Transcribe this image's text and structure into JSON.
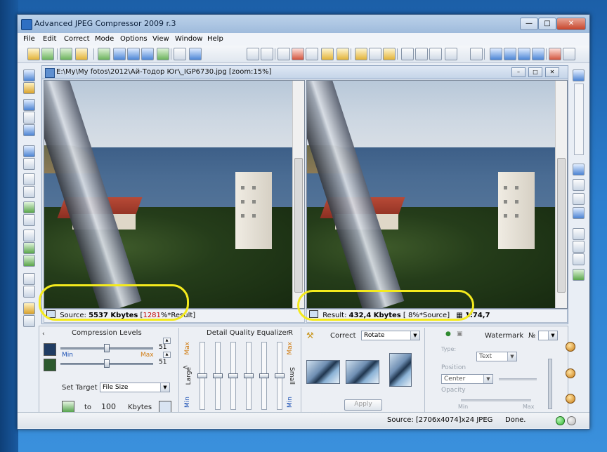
{
  "window": {
    "title": "Advanced JPEG Compressor 2009 r.3"
  },
  "menu": [
    "File",
    "Edit",
    "Correct",
    "Mode",
    "Options",
    "View",
    "Window",
    "Help"
  ],
  "document": {
    "title": "E:\\My\\My fotos\\2012\\Ай-Тодор Юг\\_IGP6730.jpg  [zoom:15%]",
    "source_label": "Source:",
    "source_size": "5537 Kbytes",
    "source_ratio_open": "[",
    "source_ratio": "1281",
    "source_ratio_suffix": "%*Result]",
    "result_label": "Result:",
    "result_size": "432,4 Kbytes",
    "result_ratio": "[ 8%*Source]",
    "compression_ratio": "1:74,7"
  },
  "compression": {
    "title": "Compression Levels",
    "min_label": "Min",
    "max_label": "Max",
    "level1": "51",
    "level2": "51",
    "level1_fraction": 0.5,
    "level2_fraction": 0.5,
    "set_target_label": "Set Target",
    "set_target_value": "File Size",
    "to_label": "to",
    "target_value": "100",
    "target_unit": "Kbytes"
  },
  "equalizer": {
    "title": "Detail Quality Equalizer",
    "r_label": "R",
    "max_label": "Max",
    "min_label": "Min",
    "large_label": "Large",
    "small_label": "Small",
    "less_glyph": "<"
  },
  "correct": {
    "label": "Correct",
    "mode": "Rotate",
    "apply_label": "Apply"
  },
  "watermark": {
    "title": "Watermark",
    "number_label": "№",
    "type_label": "Type:",
    "type_value": "Text",
    "position_label": "Position",
    "position_value": "Center",
    "opacity_label": "Opacity",
    "min_label": "Min",
    "max_label": "Max"
  },
  "statusbar": {
    "source_info": "Source: [2706x4074]x24 JPEG",
    "state": "Done."
  },
  "colors": {
    "highlight": "#f4ea1d",
    "ratio_red": "#c00000",
    "led_green": "#2fb52f",
    "led_gray": "#b9b9b9"
  }
}
